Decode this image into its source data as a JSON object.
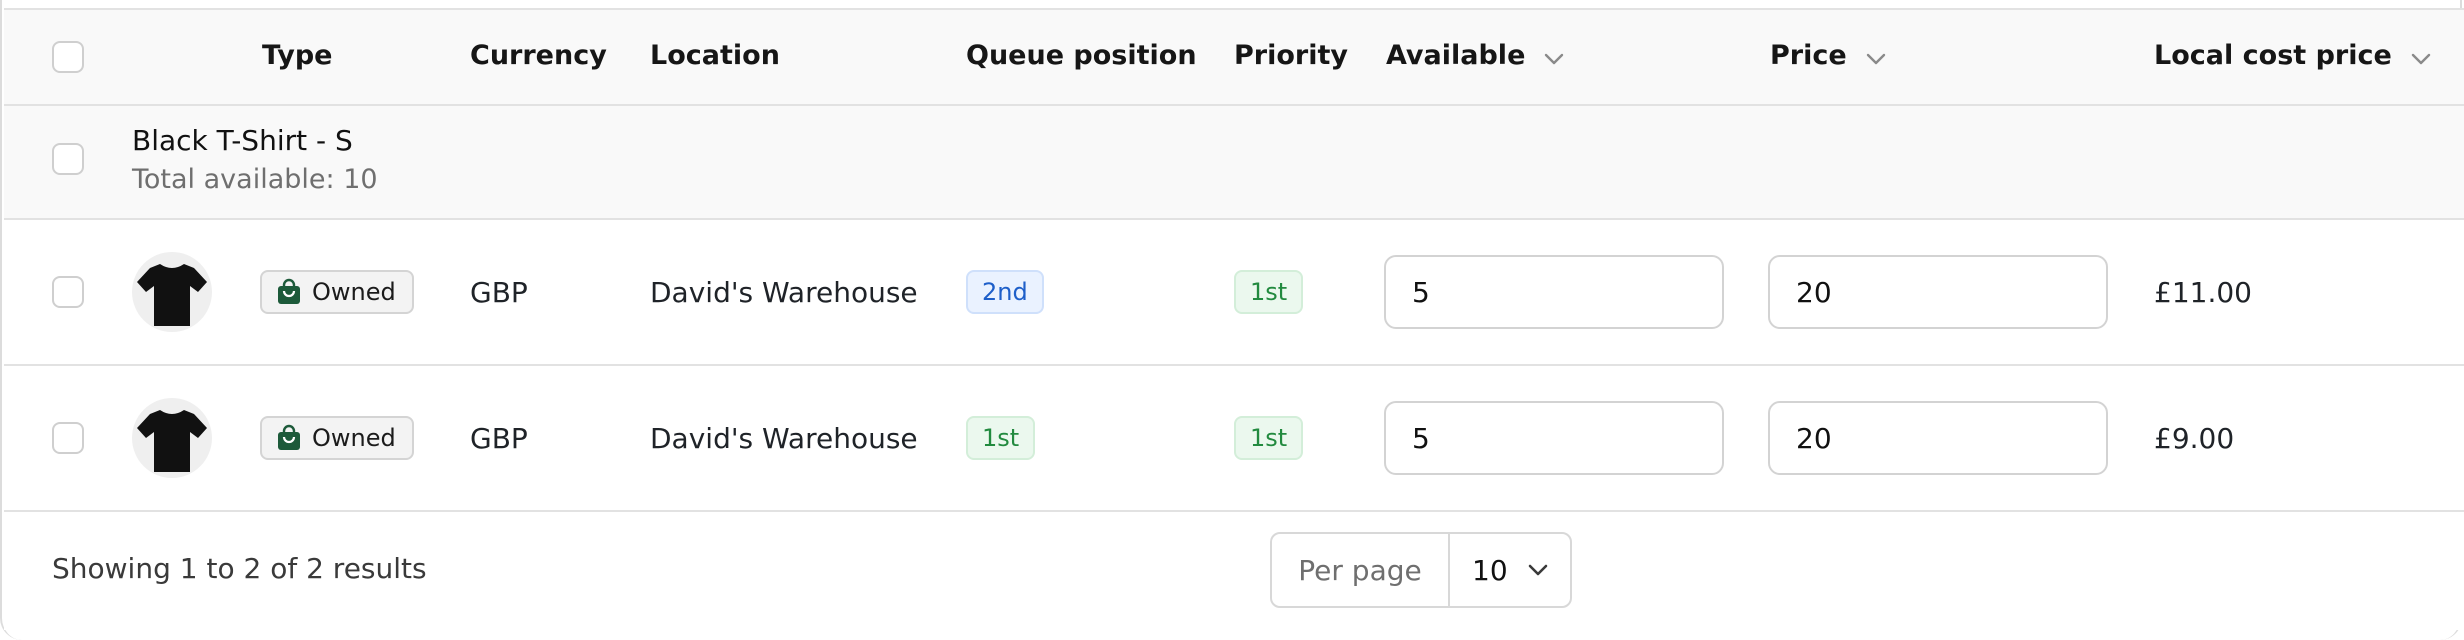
{
  "table": {
    "headers": {
      "type": "Type",
      "currency": "Currency",
      "location": "Location",
      "queue_position": "Queue position",
      "priority": "Priority",
      "available": "Available",
      "price": "Price",
      "local_cost_price": "Local cost price"
    },
    "group": {
      "title": "Black T-Shirt - S",
      "subtitle": "Total available: 10"
    },
    "rows": [
      {
        "type_label": "Owned",
        "currency": "GBP",
        "location": "David's Warehouse",
        "queue_position": "2nd",
        "priority": "1st",
        "available": "5",
        "price": "20",
        "local_cost_price": "£11.00"
      },
      {
        "type_label": "Owned",
        "currency": "GBP",
        "location": "David's Warehouse",
        "queue_position": "1st",
        "priority": "1st",
        "available": "5",
        "price": "20",
        "local_cost_price": "£9.00"
      }
    ]
  },
  "footer": {
    "results_text": "Showing 1 to 2 of 2 results",
    "per_page_label": "Per page",
    "per_page_value": "10"
  },
  "icons": {
    "chevron": "chevron-down-icon",
    "bag": "shopping-bag-icon",
    "product": "tshirt-icon"
  },
  "colors": {
    "queue_blue": "#1e5fc9",
    "priority_green": "#228a3f",
    "owned_icon": "#1d5a3a"
  }
}
